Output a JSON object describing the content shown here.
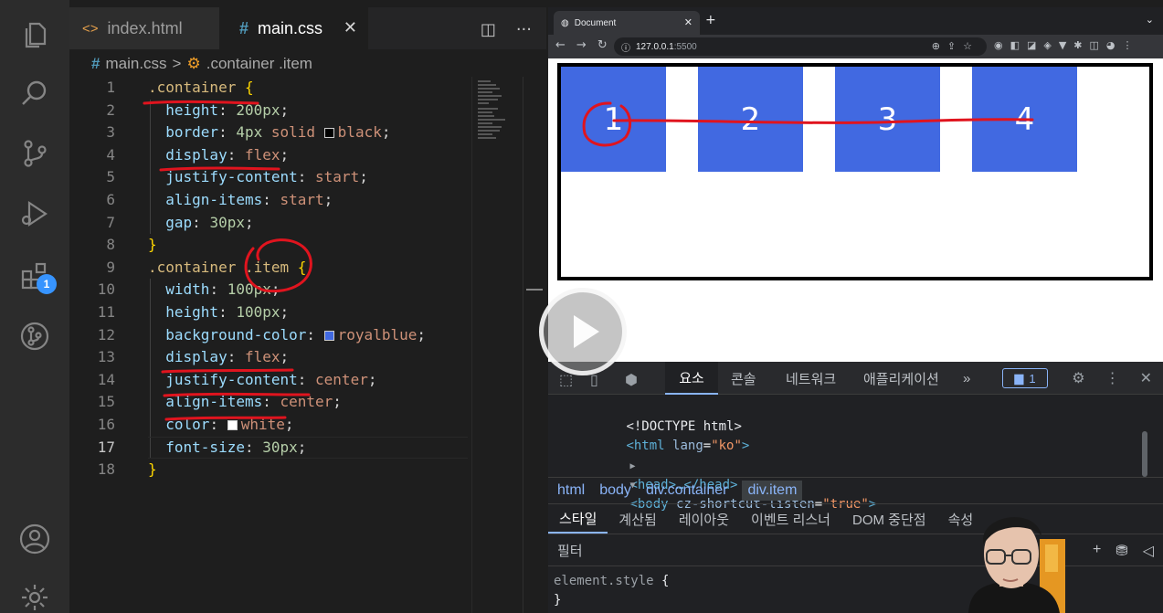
{
  "editor": {
    "tabs": [
      {
        "icon": "<>",
        "label": "index.html"
      },
      {
        "icon": "#",
        "label": "main.css",
        "close": "✕"
      }
    ],
    "actions": {
      "split": "◫",
      "more": "···"
    },
    "breadcrumb": {
      "file_icon": "#",
      "file": "main.css",
      "sep": ">",
      "symbol": ".container .item"
    },
    "lines": [
      {
        "n": "1",
        "tokens": [
          {
            "c": "t-sel",
            "t": ".container "
          },
          {
            "c": "t-brace",
            "t": "{"
          }
        ]
      },
      {
        "n": "2",
        "tokens": [
          {
            "c": "t-prop",
            "t": "  height"
          },
          {
            "c": "t-punc",
            "t": ": "
          },
          {
            "c": "t-num",
            "t": "200px"
          },
          {
            "c": "t-punc",
            "t": ";"
          }
        ]
      },
      {
        "n": "3",
        "tokens": [
          {
            "c": "t-prop",
            "t": "  border"
          },
          {
            "c": "t-punc",
            "t": ": "
          },
          {
            "c": "t-num",
            "t": "4px"
          },
          {
            "c": "t-val",
            "t": " solid "
          },
          {
            "c": "swatch-black",
            "t": ""
          },
          {
            "c": "t-val",
            "t": "black"
          },
          {
            "c": "t-punc",
            "t": ";"
          }
        ]
      },
      {
        "n": "4",
        "tokens": [
          {
            "c": "t-prop",
            "t": "  display"
          },
          {
            "c": "t-punc",
            "t": ": "
          },
          {
            "c": "t-val",
            "t": "flex"
          },
          {
            "c": "t-punc",
            "t": ";"
          }
        ]
      },
      {
        "n": "5",
        "tokens": [
          {
            "c": "t-prop",
            "t": "  justify-content"
          },
          {
            "c": "t-punc",
            "t": ": "
          },
          {
            "c": "t-val",
            "t": "start"
          },
          {
            "c": "t-punc",
            "t": ";"
          }
        ]
      },
      {
        "n": "6",
        "tokens": [
          {
            "c": "t-prop",
            "t": "  align-items"
          },
          {
            "c": "t-punc",
            "t": ": "
          },
          {
            "c": "t-val",
            "t": "start"
          },
          {
            "c": "t-punc",
            "t": ";"
          }
        ]
      },
      {
        "n": "7",
        "tokens": [
          {
            "c": "t-prop",
            "t": "  gap"
          },
          {
            "c": "t-punc",
            "t": ": "
          },
          {
            "c": "t-num",
            "t": "30px"
          },
          {
            "c": "t-punc",
            "t": ";"
          }
        ]
      },
      {
        "n": "8",
        "tokens": [
          {
            "c": "t-brace",
            "t": "}"
          }
        ]
      },
      {
        "n": "9",
        "tokens": [
          {
            "c": "t-sel",
            "t": ".container .item "
          },
          {
            "c": "t-brace",
            "t": "{"
          }
        ]
      },
      {
        "n": "10",
        "tokens": [
          {
            "c": "t-prop",
            "t": "  width"
          },
          {
            "c": "t-punc",
            "t": ": "
          },
          {
            "c": "t-num",
            "t": "100px"
          },
          {
            "c": "t-punc",
            "t": ";"
          }
        ]
      },
      {
        "n": "11",
        "tokens": [
          {
            "c": "t-prop",
            "t": "  height"
          },
          {
            "c": "t-punc",
            "t": ": "
          },
          {
            "c": "t-num",
            "t": "100px"
          },
          {
            "c": "t-punc",
            "t": ";"
          }
        ]
      },
      {
        "n": "12",
        "tokens": [
          {
            "c": "t-prop",
            "t": "  background-color"
          },
          {
            "c": "t-punc",
            "t": ": "
          },
          {
            "c": "swatch-blue",
            "t": ""
          },
          {
            "c": "t-val",
            "t": "royalblue"
          },
          {
            "c": "t-punc",
            "t": ";"
          }
        ]
      },
      {
        "n": "13",
        "tokens": [
          {
            "c": "t-prop",
            "t": "  display"
          },
          {
            "c": "t-punc",
            "t": ": "
          },
          {
            "c": "t-val",
            "t": "flex"
          },
          {
            "c": "t-punc",
            "t": ";"
          }
        ]
      },
      {
        "n": "14",
        "tokens": [
          {
            "c": "t-prop",
            "t": "  justify-content"
          },
          {
            "c": "t-punc",
            "t": ": "
          },
          {
            "c": "t-val",
            "t": "center"
          },
          {
            "c": "t-punc",
            "t": ";"
          }
        ]
      },
      {
        "n": "15",
        "tokens": [
          {
            "c": "t-prop",
            "t": "  align-items"
          },
          {
            "c": "t-punc",
            "t": ": "
          },
          {
            "c": "t-val",
            "t": "center"
          },
          {
            "c": "t-punc",
            "t": ";"
          }
        ]
      },
      {
        "n": "16",
        "tokens": [
          {
            "c": "t-prop",
            "t": "  color"
          },
          {
            "c": "t-punc",
            "t": ": "
          },
          {
            "c": "swatch-white",
            "t": ""
          },
          {
            "c": "t-val",
            "t": "white"
          },
          {
            "c": "t-punc",
            "t": ";"
          }
        ]
      },
      {
        "n": "17",
        "tokens": [
          {
            "c": "t-prop",
            "t": "  font-size"
          },
          {
            "c": "t-punc",
            "t": ": "
          },
          {
            "c": "t-num",
            "t": "30px"
          },
          {
            "c": "t-punc",
            "t": ";"
          }
        ]
      },
      {
        "n": "18",
        "tokens": [
          {
            "c": "t-brace",
            "t": "}"
          }
        ]
      }
    ],
    "active_line": "17",
    "activity_badge": "1"
  },
  "browser": {
    "tab_title": "Document",
    "tab_close": "✕",
    "new_tab": "+",
    "tab_menu": "⌄",
    "nav": {
      "back": "←",
      "forward": "→",
      "reload": "↻"
    },
    "url_host": "127.0.0.1",
    "url_port": ":5500",
    "items": [
      "1",
      "2",
      "3",
      "4"
    ]
  },
  "devtools": {
    "tabs": [
      "요소",
      "콘솔",
      "네트워크",
      "애플리케이션"
    ],
    "more": "»",
    "message_count": "1",
    "dom": {
      "doctype": "<!DOCTYPE html>",
      "html_tag": "<html",
      "lang_attr": "lang",
      "lang_val": "\"ko\"",
      "head": "<head>…</head>",
      "body_tag": "<body",
      "body_attr": "cz-shortcut-listen",
      "body_val": "\"true\""
    },
    "crumbs": [
      "html",
      "body",
      "div.container",
      "div.item"
    ],
    "style_tabs": [
      "스타일",
      "계산됨",
      "레이아웃",
      "이벤트 리스너",
      "DOM 중단점",
      "속성"
    ],
    "filter_placeholder": "필터",
    "element_style": "element.style",
    "rule_open": "{",
    "rule_close": "}"
  },
  "colors": {
    "item_blue": "#4169e1",
    "annotation_red": "#e0141e",
    "vscode_badge": "#3794ff"
  }
}
